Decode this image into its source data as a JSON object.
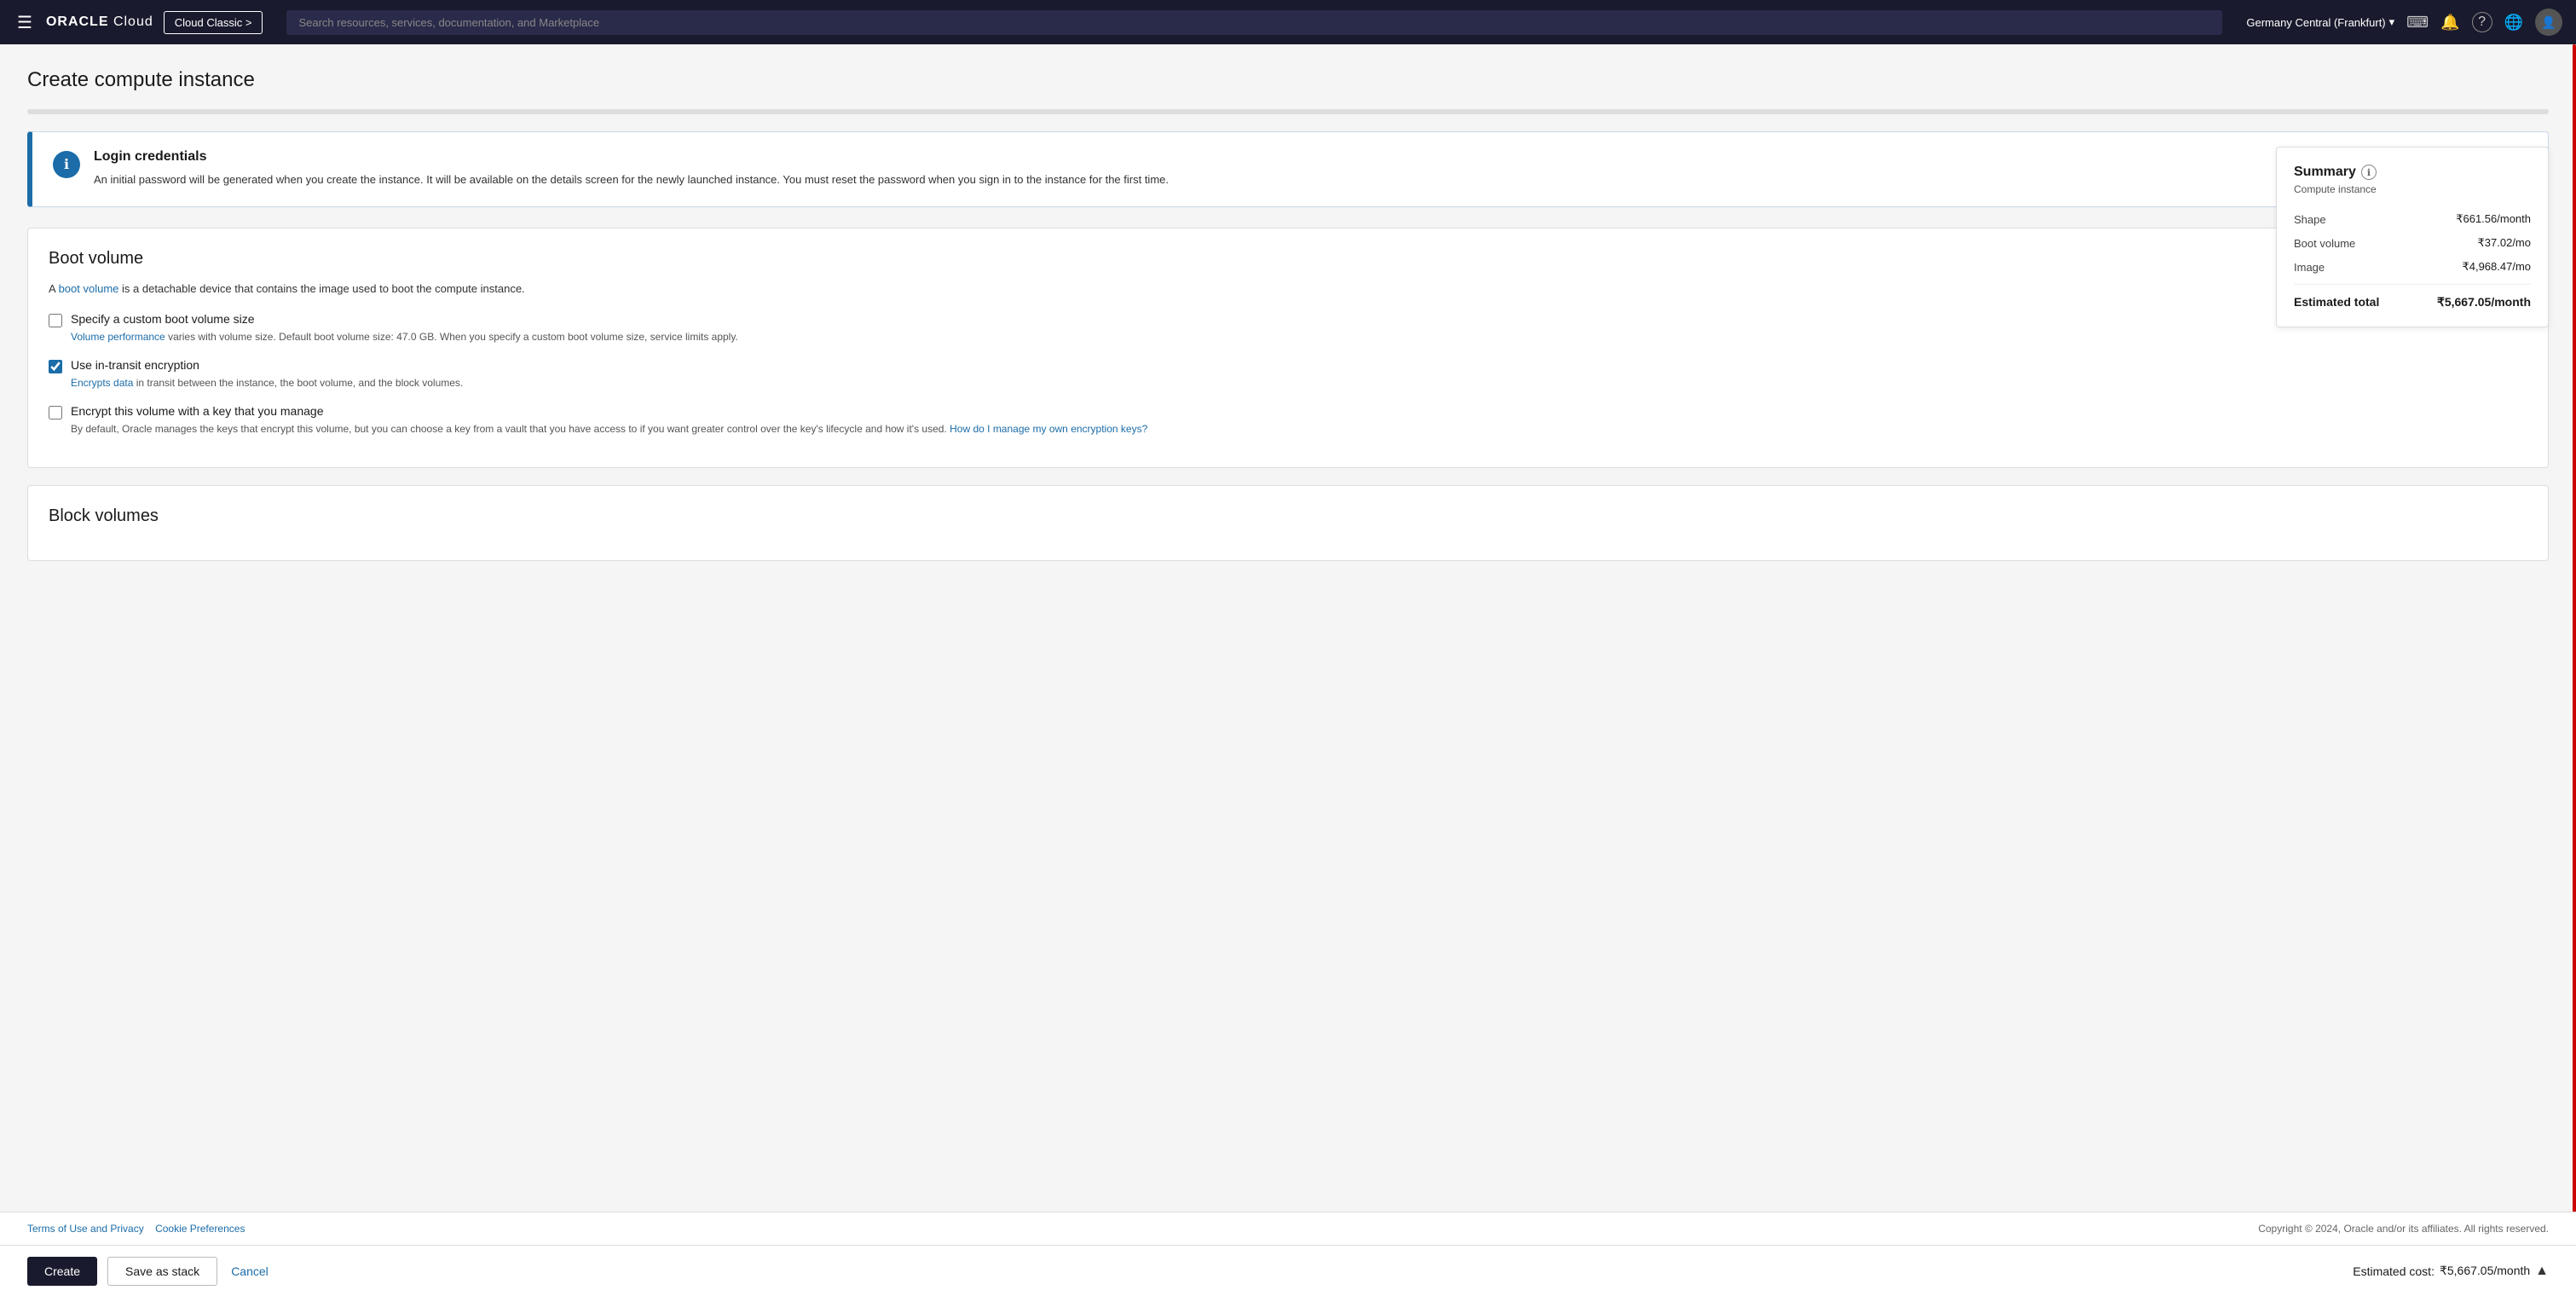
{
  "navbar": {
    "hamburger_icon": "☰",
    "logo_text": "ORACLE",
    "logo_sub": " Cloud",
    "classic_btn": "Cloud Classic >",
    "search_placeholder": "Search resources, services, documentation, and Marketplace",
    "region": "Germany Central (Frankfurt)",
    "region_chevron": "▾",
    "code_icon": "⌨",
    "bell_icon": "🔔",
    "help_icon": "?",
    "globe_icon": "🌐",
    "avatar_icon": "👤"
  },
  "page": {
    "title": "Create compute instance"
  },
  "login_credentials": {
    "title": "Login credentials",
    "description": "An initial password will be generated when you create the instance. It will be available on the details screen for the newly launched instance. You must reset the password when you sign in to the instance for the first time.",
    "icon": "ℹ"
  },
  "boot_volume": {
    "section_title": "Boot volume",
    "description_prefix": "A ",
    "description_link": "boot volume",
    "description_suffix": " is a detachable device that contains the image used to boot the compute instance.",
    "custom_size_label": "Specify a custom boot volume size",
    "custom_size_hint_prefix": "",
    "custom_size_hint_link": "Volume performance",
    "custom_size_hint_suffix": " varies with volume size. Default boot volume size: 47.0 GB. When you specify a custom boot volume size, service limits apply.",
    "custom_size_checked": false,
    "transit_label": "Use in-transit encryption",
    "transit_hint_prefix": "",
    "transit_hint_link": "Encrypts data",
    "transit_hint_suffix": " in transit between the instance, the boot volume, and the block volumes.",
    "transit_checked": true,
    "encrypt_label": "Encrypt this volume with a key that you manage",
    "encrypt_hint": "By default, Oracle manages the keys that encrypt this volume, but you can choose a key from a vault that you have access to if you want greater control over the key's lifecycle and how it's used. ",
    "encrypt_hint_link": "How do I manage my own encryption keys?",
    "encrypt_checked": false
  },
  "block_volumes": {
    "section_title": "Block volumes"
  },
  "summary": {
    "title": "Summary",
    "subtitle": "Compute instance",
    "info_icon": "ℹ",
    "shape_label": "Shape",
    "shape_value": "₹661.56/month",
    "boot_volume_label": "Boot volume",
    "boot_volume_value": "₹37.02/mo",
    "image_label": "Image",
    "image_value": "₹4,968.47/mo",
    "estimated_total_label": "Estimated total",
    "estimated_total_value": "₹5,667.05/month"
  },
  "actions": {
    "create_label": "Create",
    "save_as_stack_label": "Save as stack",
    "cancel_label": "Cancel",
    "estimated_cost_label": "Estimated cost:",
    "estimated_cost_value": "₹5,667.05/month",
    "expand_icon": "▲"
  },
  "footer": {
    "terms_link": "Terms of Use and Privacy",
    "cookies_link": "Cookie Preferences",
    "copyright": "Copyright © 2024, Oracle and/or its affiliates. All rights reserved."
  }
}
